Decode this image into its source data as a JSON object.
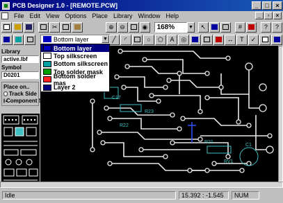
{
  "window": {
    "title": "PCB Designer 1.0 - [REMOTE.PCW]"
  },
  "menu": [
    "File",
    "Edit",
    "View",
    "Options",
    "Place",
    "Library",
    "Window",
    "Help"
  ],
  "toolbar": {
    "zoom_value": "168%"
  },
  "layer_selector": {
    "selected": "Bottom layer",
    "options": [
      {
        "label": "Bottom layer",
        "color": "#0000c0",
        "selected": true
      },
      {
        "label": "Top silkscreen",
        "color": "#ffffff"
      },
      {
        "label": "Bottom silkscreen",
        "color": "#00a0a0"
      },
      {
        "label": "Top solder mask",
        "color": "#00a000"
      },
      {
        "label": "Bottom solder mas",
        "color": "#ff2020"
      },
      {
        "label": "Layer 2",
        "color": "#000080"
      }
    ]
  },
  "left_panel": {
    "library_label": "Library",
    "library_value": "active.lbf",
    "symbol_label": "Symbol",
    "symbol_value": "D0201",
    "place_on_label": "Place on..",
    "place_on_options": [
      {
        "label": "Track Side",
        "checked": false
      },
      {
        "label": "Component Side",
        "checked": true
      }
    ]
  },
  "board": {
    "labels": [
      "RV1",
      "C17",
      "R21",
      "R22",
      "R23",
      "C1"
    ]
  },
  "status": {
    "mode": "Idle",
    "coords": "15.392 : -1.545",
    "num": "NUM"
  }
}
